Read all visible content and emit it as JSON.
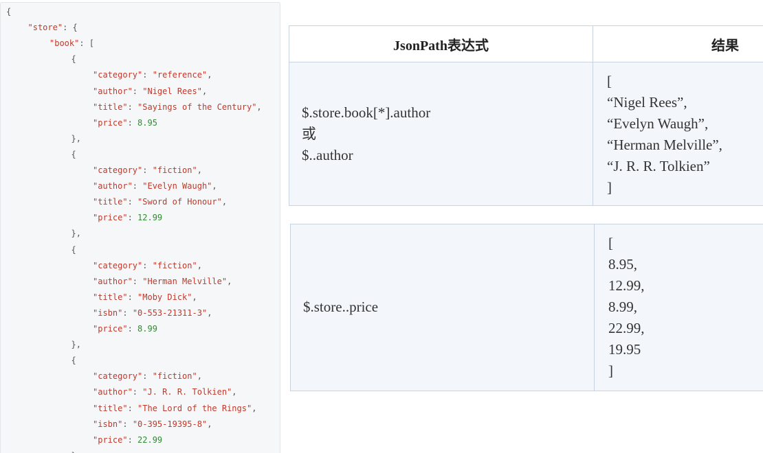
{
  "json_code": {
    "lines": [
      {
        "indent": 0,
        "tokens": [
          {
            "t": "punct",
            "v": "{"
          }
        ]
      },
      {
        "indent": 1,
        "tokens": [
          {
            "t": "key",
            "v": "\"store\""
          },
          {
            "t": "punct",
            "v": ": {"
          }
        ]
      },
      {
        "indent": 2,
        "tokens": [
          {
            "t": "key",
            "v": "\"book\""
          },
          {
            "t": "punct",
            "v": ": ["
          }
        ]
      },
      {
        "indent": 3,
        "tokens": [
          {
            "t": "punct",
            "v": "{"
          }
        ]
      },
      {
        "indent": 4,
        "tokens": [
          {
            "t": "key",
            "v": "\"category\""
          },
          {
            "t": "punct",
            "v": ": "
          },
          {
            "t": "str",
            "v": "\"reference\""
          },
          {
            "t": "punct",
            "v": ","
          }
        ]
      },
      {
        "indent": 4,
        "tokens": [
          {
            "t": "key",
            "v": "\"author\""
          },
          {
            "t": "punct",
            "v": ": "
          },
          {
            "t": "str",
            "v": "\"Nigel Rees\""
          },
          {
            "t": "punct",
            "v": ","
          }
        ]
      },
      {
        "indent": 4,
        "tokens": [
          {
            "t": "key",
            "v": "\"title\""
          },
          {
            "t": "punct",
            "v": ": "
          },
          {
            "t": "str",
            "v": "\"Sayings of the Century\""
          },
          {
            "t": "punct",
            "v": ","
          }
        ]
      },
      {
        "indent": 4,
        "tokens": [
          {
            "t": "key",
            "v": "\"price\""
          },
          {
            "t": "punct",
            "v": ": "
          },
          {
            "t": "num",
            "v": "8.95"
          }
        ]
      },
      {
        "indent": 3,
        "tokens": [
          {
            "t": "punct",
            "v": "},"
          }
        ]
      },
      {
        "indent": 3,
        "tokens": [
          {
            "t": "punct",
            "v": "{"
          }
        ]
      },
      {
        "indent": 4,
        "tokens": [
          {
            "t": "key",
            "v": "\"category\""
          },
          {
            "t": "punct",
            "v": ": "
          },
          {
            "t": "str",
            "v": "\"fiction\""
          },
          {
            "t": "punct",
            "v": ","
          }
        ]
      },
      {
        "indent": 4,
        "tokens": [
          {
            "t": "key",
            "v": "\"author\""
          },
          {
            "t": "punct",
            "v": ": "
          },
          {
            "t": "str",
            "v": "\"Evelyn Waugh\""
          },
          {
            "t": "punct",
            "v": ","
          }
        ]
      },
      {
        "indent": 4,
        "tokens": [
          {
            "t": "key",
            "v": "\"title\""
          },
          {
            "t": "punct",
            "v": ": "
          },
          {
            "t": "str",
            "v": "\"Sword of Honour\""
          },
          {
            "t": "punct",
            "v": ","
          }
        ]
      },
      {
        "indent": 4,
        "tokens": [
          {
            "t": "key",
            "v": "\"price\""
          },
          {
            "t": "punct",
            "v": ": "
          },
          {
            "t": "num",
            "v": "12.99"
          }
        ]
      },
      {
        "indent": 3,
        "tokens": [
          {
            "t": "punct",
            "v": "},"
          }
        ]
      },
      {
        "indent": 3,
        "tokens": [
          {
            "t": "punct",
            "v": "{"
          }
        ]
      },
      {
        "indent": 4,
        "tokens": [
          {
            "t": "key",
            "v": "\"category\""
          },
          {
            "t": "punct",
            "v": ": "
          },
          {
            "t": "str",
            "v": "\"fiction\""
          },
          {
            "t": "punct",
            "v": ","
          }
        ]
      },
      {
        "indent": 4,
        "tokens": [
          {
            "t": "key",
            "v": "\"author\""
          },
          {
            "t": "punct",
            "v": ": "
          },
          {
            "t": "str",
            "v": "\"Herman Melville\""
          },
          {
            "t": "punct",
            "v": ","
          }
        ]
      },
      {
        "indent": 4,
        "tokens": [
          {
            "t": "key",
            "v": "\"title\""
          },
          {
            "t": "punct",
            "v": ": "
          },
          {
            "t": "str",
            "v": "\"Moby Dick\""
          },
          {
            "t": "punct",
            "v": ","
          }
        ]
      },
      {
        "indent": 4,
        "tokens": [
          {
            "t": "key",
            "v": "\"isbn\""
          },
          {
            "t": "punct",
            "v": ": "
          },
          {
            "t": "str",
            "v": "\"0-553-21311-3\""
          },
          {
            "t": "punct",
            "v": ","
          }
        ]
      },
      {
        "indent": 4,
        "tokens": [
          {
            "t": "key",
            "v": "\"price\""
          },
          {
            "t": "punct",
            "v": ": "
          },
          {
            "t": "num",
            "v": "8.99"
          }
        ]
      },
      {
        "indent": 3,
        "tokens": [
          {
            "t": "punct",
            "v": "},"
          }
        ]
      },
      {
        "indent": 3,
        "tokens": [
          {
            "t": "punct",
            "v": "{"
          }
        ]
      },
      {
        "indent": 4,
        "tokens": [
          {
            "t": "key",
            "v": "\"category\""
          },
          {
            "t": "punct",
            "v": ": "
          },
          {
            "t": "str",
            "v": "\"fiction\""
          },
          {
            "t": "punct",
            "v": ","
          }
        ]
      },
      {
        "indent": 4,
        "tokens": [
          {
            "t": "key",
            "v": "\"author\""
          },
          {
            "t": "punct",
            "v": ": "
          },
          {
            "t": "str",
            "v": "\"J. R. R. Tolkien\""
          },
          {
            "t": "punct",
            "v": ","
          }
        ]
      },
      {
        "indent": 4,
        "tokens": [
          {
            "t": "key",
            "v": "\"title\""
          },
          {
            "t": "punct",
            "v": ": "
          },
          {
            "t": "str",
            "v": "\"The Lord of the Rings\""
          },
          {
            "t": "punct",
            "v": ","
          }
        ]
      },
      {
        "indent": 4,
        "tokens": [
          {
            "t": "key",
            "v": "\"isbn\""
          },
          {
            "t": "punct",
            "v": ": "
          },
          {
            "t": "str",
            "v": "\"0-395-19395-8\""
          },
          {
            "t": "punct",
            "v": ","
          }
        ]
      },
      {
        "indent": 4,
        "tokens": [
          {
            "t": "key",
            "v": "\"price\""
          },
          {
            "t": "punct",
            "v": ": "
          },
          {
            "t": "num",
            "v": "22.99"
          }
        ]
      },
      {
        "indent": 3,
        "tokens": [
          {
            "t": "punct",
            "v": "}"
          }
        ]
      }
    ]
  },
  "table": {
    "headers": {
      "expression": "JsonPath表达式",
      "result": "结果"
    },
    "rows": [
      {
        "expression_lines": [
          "$.store.book[*].author",
          "或",
          "$..author"
        ],
        "result_lines": [
          "[",
          "“Nigel Rees”,",
          "“Evelyn Waugh”,",
          "“Herman Melville”,",
          "“J. R. R. Tolkien”",
          "]"
        ]
      },
      {
        "expression_lines": [
          "$.store..price"
        ],
        "result_lines": [
          "[",
          "8.95,",
          "12.99,",
          "8.99,",
          "22.99,",
          "19.95",
          "]"
        ]
      }
    ]
  },
  "colors": {
    "json_key": "#c0392b",
    "json_number": "#2e8b2e",
    "table_border": "#c9d3df",
    "table_body_bg": "#f3f7fb"
  }
}
